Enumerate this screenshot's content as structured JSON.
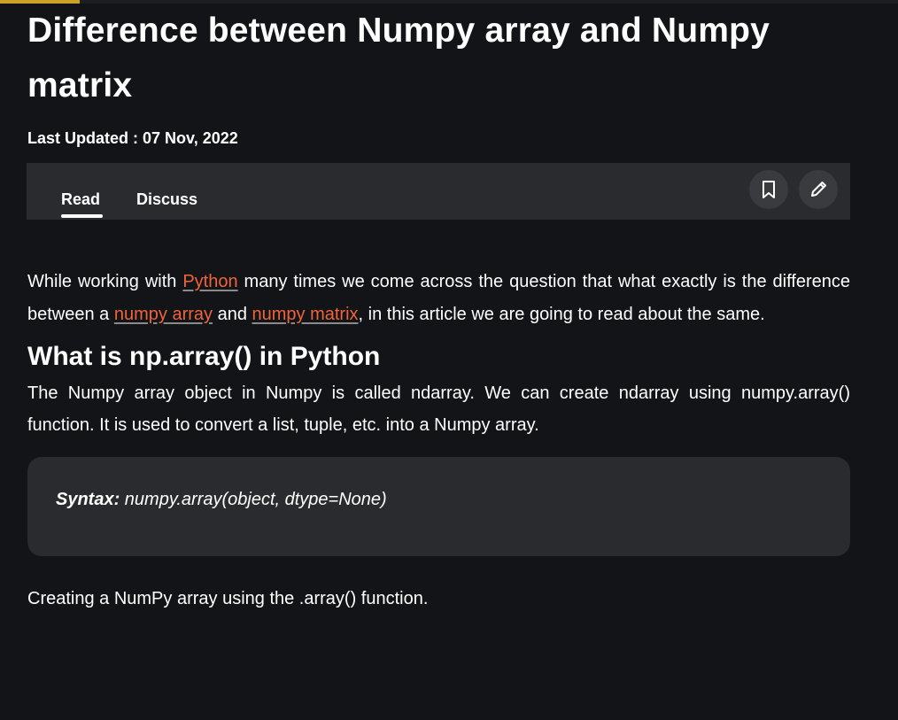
{
  "article": {
    "title": "Difference between Numpy array and Numpy matrix",
    "last_updated": "Last Updated : 07 Nov, 2022"
  },
  "tabs": {
    "read": "Read",
    "discuss": "Discuss"
  },
  "toolbar_icons": [
    "bookmark-icon",
    "edit-pencil-icon"
  ],
  "intro": {
    "part1": "While working with ",
    "link_python": "Python",
    "part2": " many times we come across the question that what exactly is the difference between a ",
    "link_array": "numpy array",
    "part3": " and ",
    "link_matrix": "numpy matrix",
    "part4": ", in this article we are going to read about the same."
  },
  "section1": {
    "heading": "What is np.array() in Python",
    "body": "The Numpy array object in Numpy is called ndarray. We can create ndarray using numpy.array() function. It is used to convert a list, tuple, etc. into a Numpy array.",
    "syntax_label": "Syntax:",
    "syntax_code": " numpy.array(object, dtype=None)",
    "after_syntax": "Creating a NumPy array using the .array() function."
  },
  "colors": {
    "background": "#131417",
    "panel": "#2a2b2e",
    "link": "#f0643a",
    "accent": "#c9a227"
  }
}
